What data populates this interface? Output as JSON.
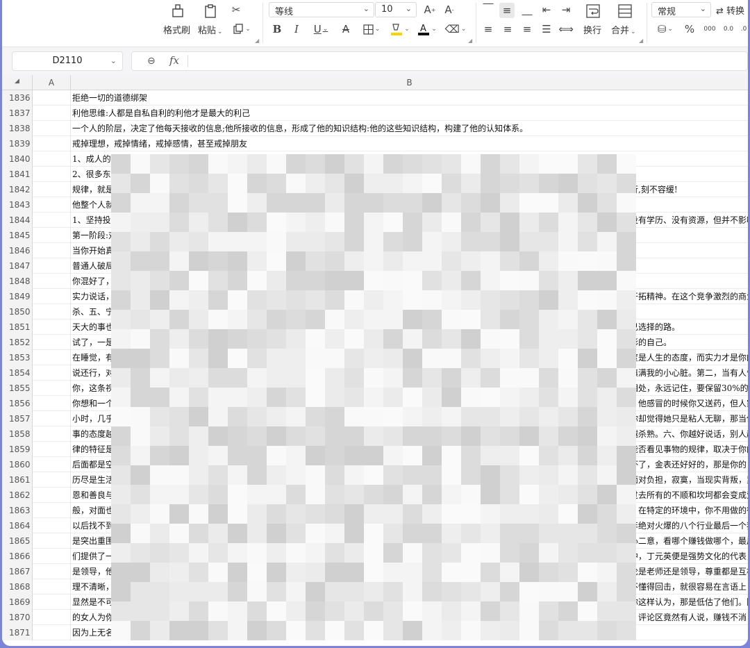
{
  "toolbar": {
    "format_painter_label": "格式刷",
    "paste_label": "粘贴",
    "font_name": "等线",
    "font_size": "10",
    "wrap_label": "换行",
    "merge_label": "合并",
    "number_format": "常规",
    "convert_label": "转换",
    "percent_symbol": "%",
    "thousands_symbol": "000",
    "decimal_symbol": "0.0"
  },
  "formula_bar": {
    "cell_ref": "D2110",
    "fx_label": "fx",
    "formula": ""
  },
  "columns": [
    "A",
    "B"
  ],
  "rows": [
    {
      "num": "1836",
      "left": "拒绝一切的道德绑架",
      "right": ""
    },
    {
      "num": "1837",
      "left": "利他思维:人都是自私自利的利他才是最大的利己",
      "right": ""
    },
    {
      "num": "1838",
      "left": "一个人的阶层，决定了他每天接收的信息;他所接收的信息，形成了他的知识结构:他的这些知识结构，构建了他的认知体系。",
      "right": ""
    },
    {
      "num": "1839",
      "left": "戒掉理想，戒掉情绪，戒掉感情，甚至戒掉朋友",
      "right": ""
    },
    {
      "num": "1840",
      "left": "1、成人的",
      "right": ""
    },
    {
      "num": "1841",
      "left": "2、很多东",
      "right": ""
    },
    {
      "num": "1842",
      "left": "规律，就是",
      "right": "行,刻不容缓!"
    },
    {
      "num": "1843",
      "left": "他整个人就",
      "right": ""
    },
    {
      "num": "1844",
      "left": "1、坚持投",
      "right": "没有学历、没有资源，但并不影响"
    },
    {
      "num": "1845",
      "left": "第一阶段:对",
      "right": ""
    },
    {
      "num": "1846",
      "left": "当你开始真",
      "right": ""
    },
    {
      "num": "1847",
      "left": "普通人破局",
      "right": ""
    },
    {
      "num": "1848",
      "left": "你混好了，",
      "right": ""
    },
    {
      "num": "1849",
      "left": "实力说话，",
      "right": "开拓精神。在这个竞争激烈的商业"
    },
    {
      "num": "1850",
      "left": "杀、五、宁",
      "right": ""
    },
    {
      "num": "1851",
      "left": "天大的事也",
      "right": "己选择的路。"
    },
    {
      "num": "1852",
      "left": "试了，一是",
      "right": "彩的自己。"
    },
    {
      "num": "1853",
      "left": "在睡觉，有",
      "right": "度是人生的态度，而实力才是你的"
    },
    {
      "num": "1854",
      "left": "说还行，对",
      "right": "填满我的小心脏。第二，当有人告"
    },
    {
      "num": "1855",
      "left": "你，这条视",
      "right": "相处，永远记住，要保留30%的神"
    },
    {
      "num": "1856",
      "left": "你想和一个",
      "right": "，他感冒的时候你又送药，但人家"
    },
    {
      "num": "1857",
      "left": "小时，几乎",
      "right": "你却觉得她只是粘人无聊，那当他"
    },
    {
      "num": "1858",
      "left": "事的态度越",
      "right": "越杀熟。六、你越好说话，别人越"
    },
    {
      "num": "1859",
      "left": "律的特征是",
      "right": "能否看见事物的规律，取决于你的"
    },
    {
      "num": "1860",
      "left": "后面都是空",
      "right": "坏了，金表还好好的，那是你的"
    },
    {
      "num": "1861",
      "left": "历尽是生活",
      "right": "面对负担，寂寞，当现实背叛，累"
    },
    {
      "num": "1862",
      "left": "恩和善良与",
      "right": "过去所有的不顺和坎坷都会变成爱"
    },
    {
      "num": "1863",
      "left": "般，对面也",
      "right": "。在特定的环境中，你不用做的很"
    },
    {
      "num": "1864",
      "left": "以后找不到",
      "right": "年绝对火爆的八个行业最后一个我"
    },
    {
      "num": "1865",
      "left": "是突出重围",
      "right": "心二意，看哪个赚钱做哪个，最后"
    },
    {
      "num": "1866",
      "left": "们提供了一",
      "right": "中，丁元英便是强势文化的代表，"
    },
    {
      "num": "1867",
      "left": "是领导，他",
      "right": "论是老师还是领导，尊重都是互相"
    },
    {
      "num": "1868",
      "left": "理不清晰，",
      "right": "不懂得回击，就很容易在言语上"
    },
    {
      "num": "1869",
      "left": "显然是不可",
      "right": "你这样认为，那是低估了他们。随"
    },
    {
      "num": "1870",
      "left": "的女人为你",
      "right": "，评论区竟然有人说，赚钱不消"
    },
    {
      "num": "1871",
      "left": "因为上无名",
      "right": ""
    }
  ]
}
